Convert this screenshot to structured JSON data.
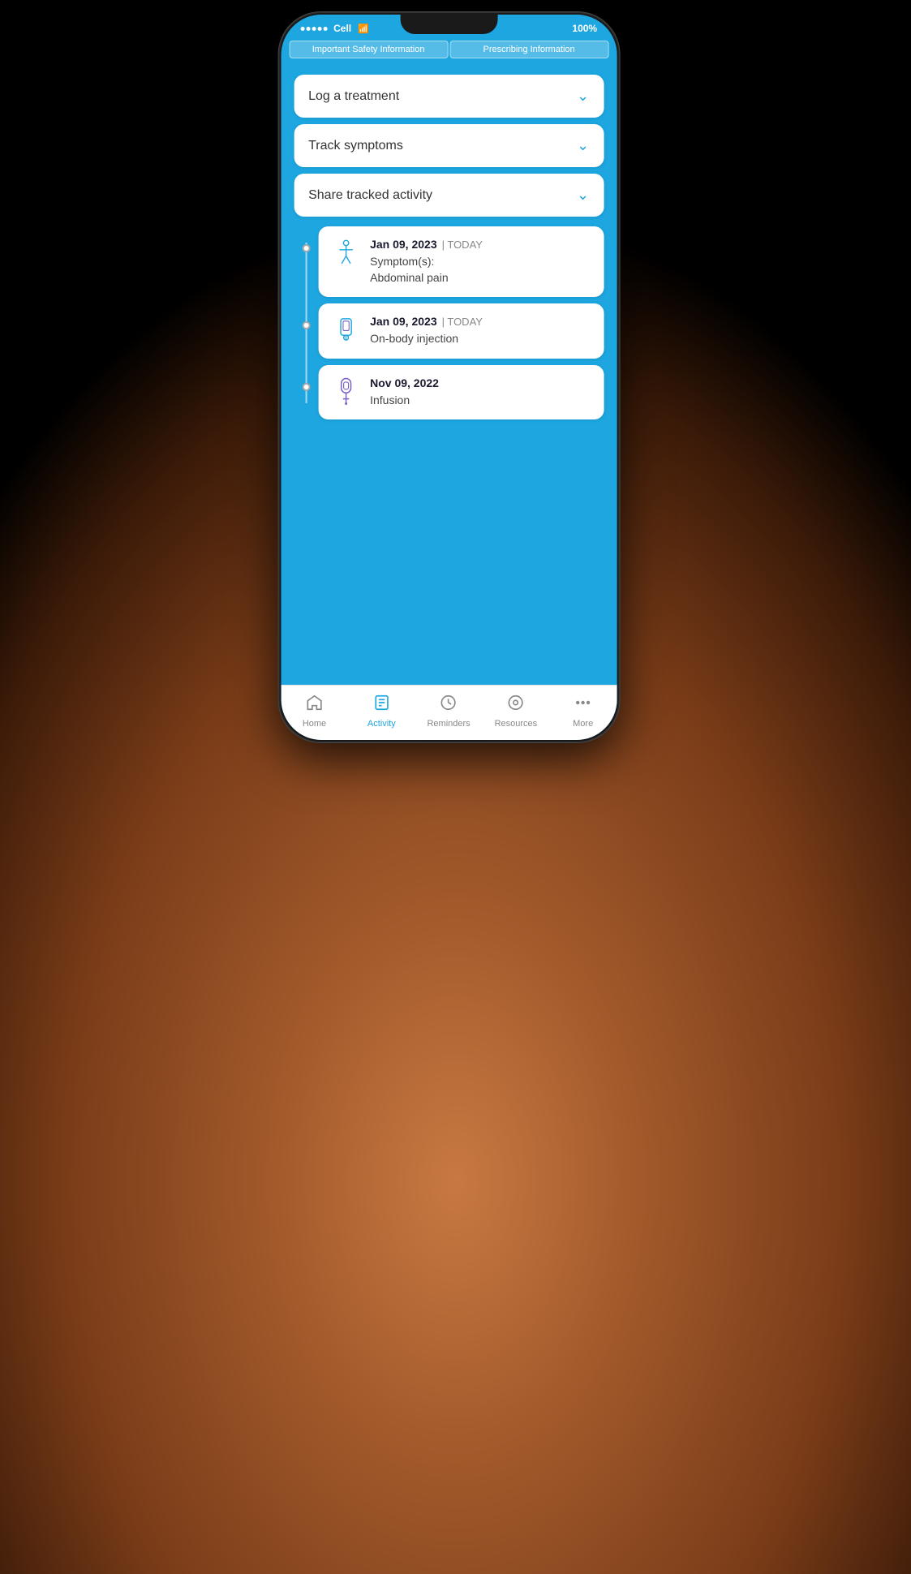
{
  "phone": {
    "status": {
      "carrier": "Cell",
      "signal_dots": 5,
      "wifi": "▲",
      "battery": "100%"
    },
    "safety_bar": {
      "btn1": "Important Safety Information",
      "btn2": "Prescribing Information"
    },
    "accordion": {
      "item1": "Log a treatment",
      "item2": "Track symptoms",
      "item3": "Share tracked activity"
    },
    "timeline": [
      {
        "date": "Jan 09, 2023",
        "today_label": "| TODAY",
        "description_line1": "Symptom(s):",
        "description_line2": "Abdominal pain",
        "icon_type": "person"
      },
      {
        "date": "Jan 09, 2023",
        "today_label": "| TODAY",
        "description_line1": "On-body injection",
        "description_line2": "",
        "icon_type": "injection"
      },
      {
        "date": "Nov 09, 2022",
        "today_label": "",
        "description_line1": "Infusion",
        "description_line2": "",
        "icon_type": "infusion"
      }
    ],
    "bottom_nav": [
      {
        "label": "Home",
        "icon": "home",
        "active": false
      },
      {
        "label": "Activity",
        "icon": "activity",
        "active": true
      },
      {
        "label": "Reminders",
        "icon": "reminders",
        "active": false
      },
      {
        "label": "Resources",
        "icon": "resources",
        "active": false
      },
      {
        "label": "More",
        "icon": "more",
        "active": false
      }
    ]
  }
}
